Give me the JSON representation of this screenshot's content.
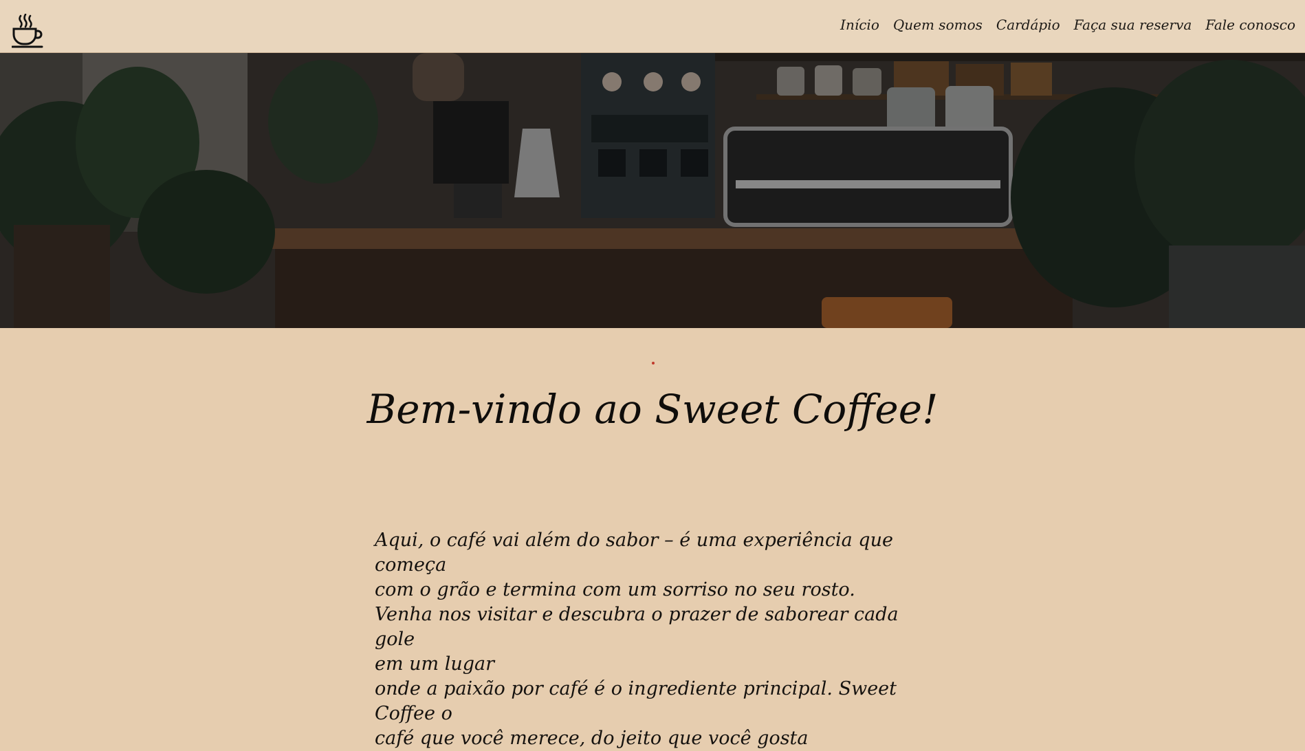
{
  "header": {
    "logo_icon": "coffee-cup-icon",
    "nav": [
      {
        "label": "Início"
      },
      {
        "label": "Quem somos"
      },
      {
        "label": "Cardápio"
      },
      {
        "label": "Faça sua reserva"
      },
      {
        "label": "Fale conosco"
      }
    ]
  },
  "hero": {
    "image_subject": "coffee-shop-counter-photo"
  },
  "main": {
    "title": "Bem-vindo ao Sweet Coffee!",
    "paragraph_lines": [
      "Aqui, o café vai além do sabor – é uma experiência que começa",
      "com o grão e termina com um sorriso no seu rosto.",
      "Venha nos visitar e descubra o prazer de saborear cada gole",
      "em um lugar",
      "onde a paixão por café é o ingrediente principal. Sweet Coffee o",
      "café que você merece, do jeito que você gosta"
    ]
  },
  "colors": {
    "header_bg": "#e9d6bd",
    "page_bg": "#e6cdaf",
    "text": "#141210"
  }
}
